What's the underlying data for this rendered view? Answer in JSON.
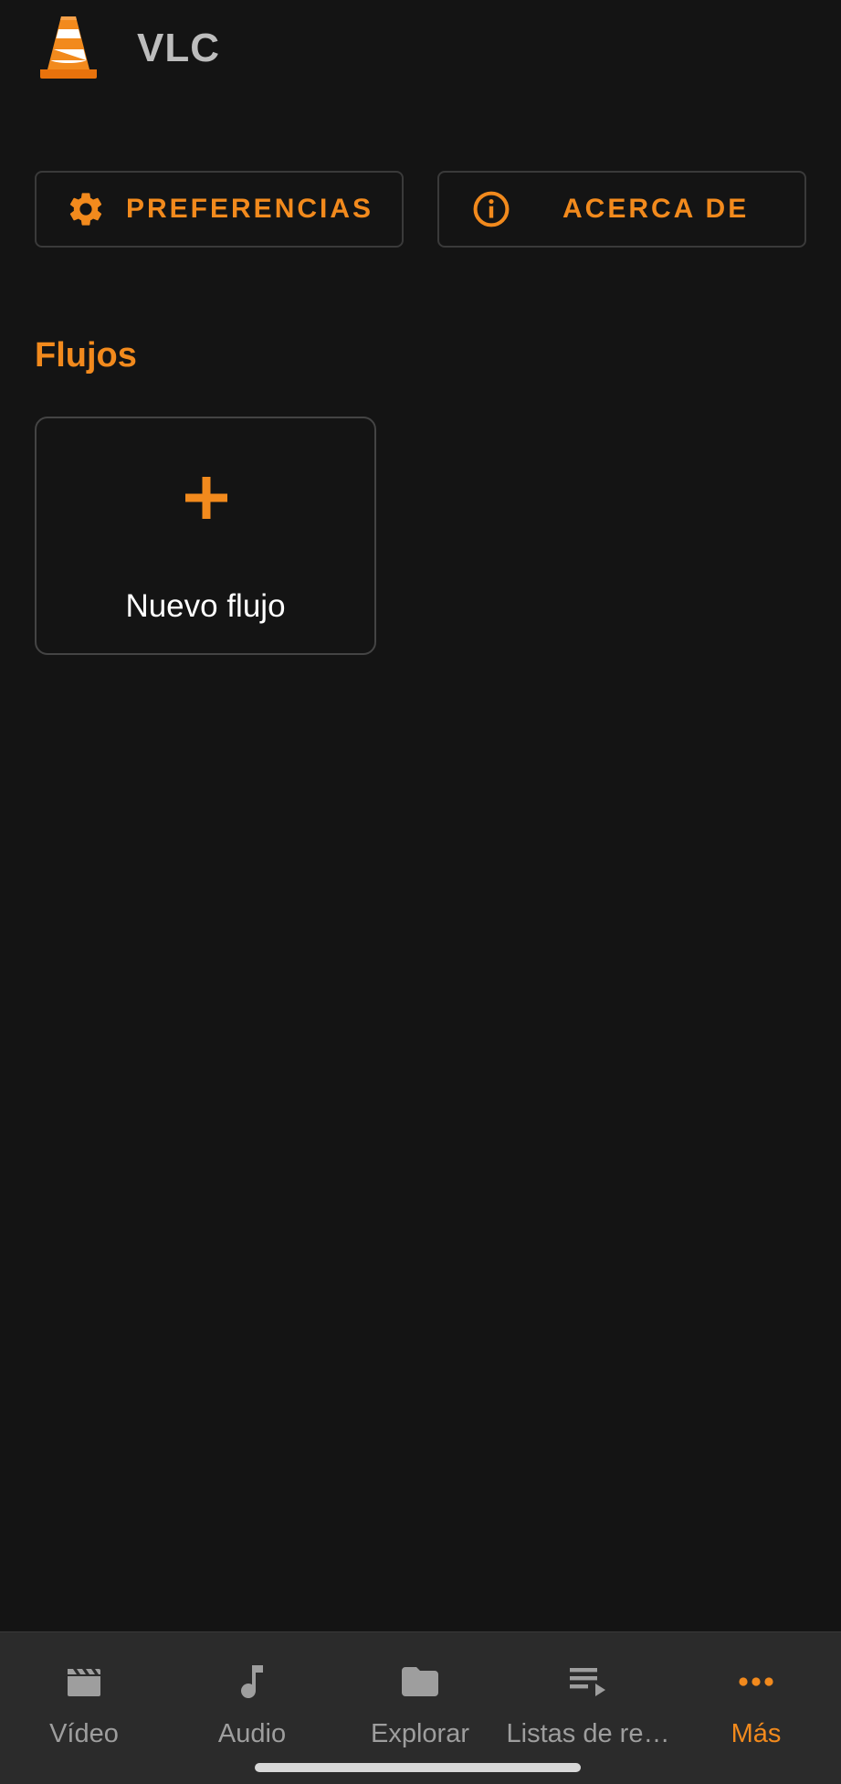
{
  "app": {
    "title": "VLC"
  },
  "actions": {
    "preferences_label": "PREFERENCIAS",
    "about_label": "ACERCA DE"
  },
  "streams_section": {
    "title": "Flujos",
    "new_stream_label": "Nuevo flujo"
  },
  "bottom_nav": {
    "items": [
      {
        "label": "Vídeo",
        "icon": "video-icon",
        "active": false
      },
      {
        "label": "Audio",
        "icon": "music-note-icon",
        "active": false
      },
      {
        "label": "Explorar",
        "icon": "folder-icon",
        "active": false
      },
      {
        "label": "Listas de re…",
        "icon": "playlist-icon",
        "active": false
      },
      {
        "label": "Más",
        "icon": "more-icon",
        "active": true
      }
    ]
  },
  "colors": {
    "accent": "#f28a1d",
    "background": "#141414",
    "nav_background": "#2b2b2b",
    "inactive": "#9e9e9e"
  }
}
